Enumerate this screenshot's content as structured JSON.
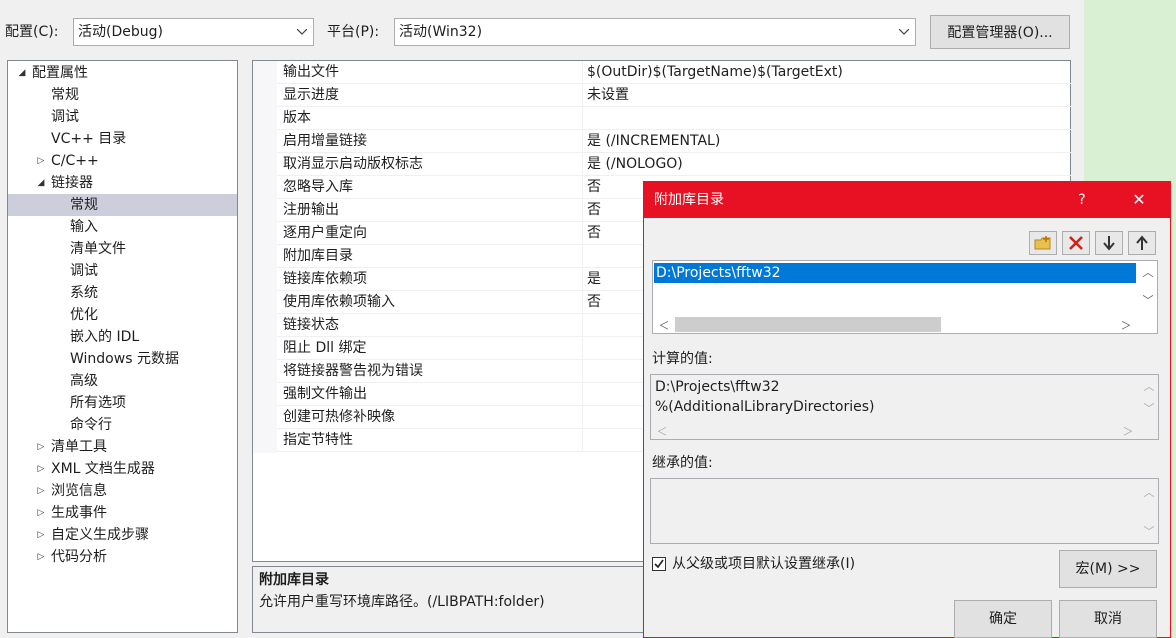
{
  "toolbar": {
    "config_label": "配置(C):",
    "config_value": "活动(Debug)",
    "platform_label": "平台(P):",
    "platform_value": "活动(Win32)",
    "config_manager_button": "配置管理器(O)..."
  },
  "tree": {
    "root": "配置属性",
    "items": [
      {
        "label": "常规",
        "level": 1,
        "expander": ""
      },
      {
        "label": "调试",
        "level": 1,
        "expander": ""
      },
      {
        "label": "VC++ 目录",
        "level": 1,
        "expander": ""
      },
      {
        "label": "C/C++",
        "level": 1,
        "expander": "collapsed"
      },
      {
        "label": "链接器",
        "level": 1,
        "expander": "expanded"
      },
      {
        "label": "常规",
        "level": 2,
        "expander": "",
        "selected": true
      },
      {
        "label": "输入",
        "level": 2,
        "expander": ""
      },
      {
        "label": "清单文件",
        "level": 2,
        "expander": ""
      },
      {
        "label": "调试",
        "level": 2,
        "expander": ""
      },
      {
        "label": "系统",
        "level": 2,
        "expander": ""
      },
      {
        "label": "优化",
        "level": 2,
        "expander": ""
      },
      {
        "label": "嵌入的 IDL",
        "level": 2,
        "expander": ""
      },
      {
        "label": "Windows 元数据",
        "level": 2,
        "expander": ""
      },
      {
        "label": "高级",
        "level": 2,
        "expander": ""
      },
      {
        "label": "所有选项",
        "level": 2,
        "expander": ""
      },
      {
        "label": "命令行",
        "level": 2,
        "expander": ""
      },
      {
        "label": "清单工具",
        "level": 1,
        "expander": "collapsed"
      },
      {
        "label": "XML 文档生成器",
        "level": 1,
        "expander": "collapsed"
      },
      {
        "label": "浏览信息",
        "level": 1,
        "expander": "collapsed"
      },
      {
        "label": "生成事件",
        "level": 1,
        "expander": "collapsed"
      },
      {
        "label": "自定义生成步骤",
        "level": 1,
        "expander": "collapsed"
      },
      {
        "label": "代码分析",
        "level": 1,
        "expander": "collapsed"
      }
    ]
  },
  "grid": {
    "rows": [
      {
        "name": "输出文件",
        "value": "$(OutDir)$(TargetName)$(TargetExt)"
      },
      {
        "name": "显示进度",
        "value": "未设置"
      },
      {
        "name": "版本",
        "value": ""
      },
      {
        "name": "启用增量链接",
        "value": "是 (/INCREMENTAL)"
      },
      {
        "name": "取消显示启动版权标志",
        "value": "是 (/NOLOGO)"
      },
      {
        "name": "忽略导入库",
        "value": "否"
      },
      {
        "name": "注册输出",
        "value": "否"
      },
      {
        "name": "逐用户重定向",
        "value": "否"
      },
      {
        "name": "附加库目录",
        "value": ""
      },
      {
        "name": "链接库依赖项",
        "value": "是"
      },
      {
        "name": "使用库依赖项输入",
        "value": "否"
      },
      {
        "name": "链接状态",
        "value": ""
      },
      {
        "name": "阻止 Dll 绑定",
        "value": ""
      },
      {
        "name": "将链接器警告视为错误",
        "value": ""
      },
      {
        "name": "强制文件输出",
        "value": ""
      },
      {
        "name": "创建可热修补映像",
        "value": ""
      },
      {
        "name": "指定节特性",
        "value": ""
      }
    ]
  },
  "description": {
    "title": "附加库目录",
    "text": "允许用户重写环境库路径。(/LIBPATH:folder)"
  },
  "dialog": {
    "title": "附加库目录",
    "help": "?",
    "close": "✕",
    "entries": [
      "D:\\Projects\\fftw32"
    ],
    "computed_label": "计算的值:",
    "computed_lines": [
      "D:\\Projects\\fftw32",
      "%(AdditionalLibraryDirectories)"
    ],
    "inherited_label": "继承的值:",
    "inherit_checkbox_label": "从父级或项目默认设置继承(I)",
    "inherit_checked": true,
    "macro_button": "宏(M) >>",
    "ok_button": "确定",
    "cancel_button": "取消"
  },
  "colors": {
    "dialog_accent": "#e81123",
    "selection": "#0078d7",
    "tree_selection": "#cccedb"
  }
}
